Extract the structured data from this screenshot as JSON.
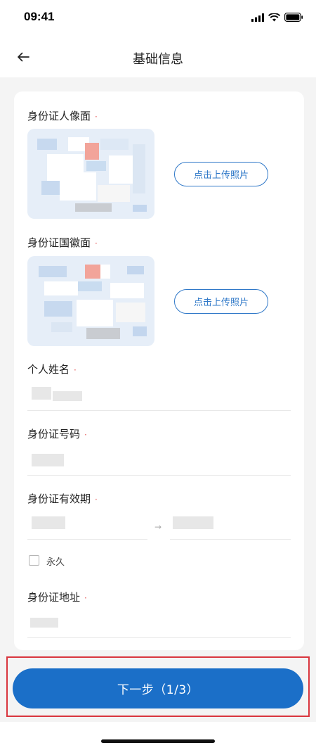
{
  "status_bar": {
    "time": "09:41"
  },
  "nav": {
    "title": "基础信息"
  },
  "form": {
    "id_front": {
      "label": "身份证人像面",
      "required_mark": "·",
      "upload_label": "点击上传照片"
    },
    "id_back": {
      "label": "身份证国徽面",
      "required_mark": "·",
      "upload_label": "点击上传照片"
    },
    "name": {
      "label": "个人姓名",
      "required_mark": "·"
    },
    "id_number": {
      "label": "身份证号码",
      "required_mark": "·"
    },
    "validity": {
      "label": "身份证有效期",
      "required_mark": "·",
      "separator": "→"
    },
    "permanent": {
      "label": "永久",
      "checked": false
    },
    "address": {
      "label": "身份证地址",
      "required_mark": "·"
    }
  },
  "footer": {
    "next_label": "下一步（1/3）"
  },
  "colors": {
    "accent": "#1b6fc8",
    "required": "#e65a5a",
    "highlight": "#d9363e"
  }
}
